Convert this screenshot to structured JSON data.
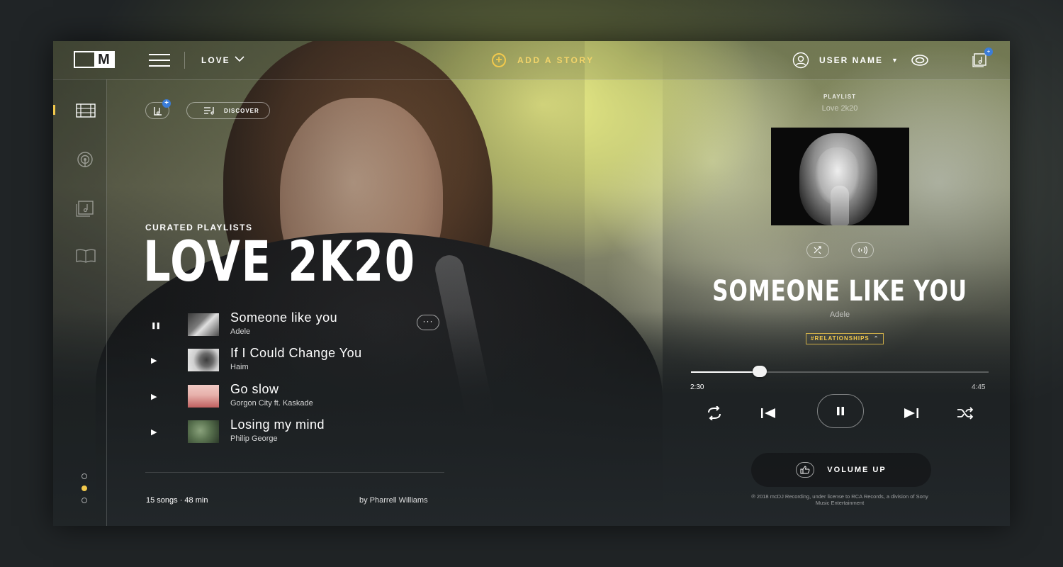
{
  "header": {
    "nav_current": "LOVE",
    "add_story_label": "ADD A STORY",
    "user_name": "USER NAME",
    "library_badge": "+"
  },
  "sidebar": {
    "items": [
      {
        "icon": "film-icon",
        "active": true
      },
      {
        "icon": "podcast-icon",
        "active": false
      },
      {
        "icon": "music-library-icon",
        "active": false
      },
      {
        "icon": "book-icon",
        "active": false
      }
    ],
    "page_indicator": {
      "count": 3,
      "active_index": 1
    }
  },
  "left": {
    "add_badge": "+",
    "discover_label": "DISCOVER",
    "eyebrow": "CURATED PLAYLISTS",
    "title": "LOVE 2K20",
    "more_label": "···",
    "tracks": [
      {
        "state": "pause",
        "state_glyph": "❚❚",
        "title": "Someone like you",
        "artist": "Adele",
        "thumb_colors": [
          "#6b6b6b",
          "#d6d6d6"
        ]
      },
      {
        "state": "play",
        "state_glyph": "▶",
        "title": "If I Could Change You",
        "artist": "Haim",
        "thumb_colors": [
          "#c9c9c9",
          "#5a5a5a"
        ]
      },
      {
        "state": "play",
        "state_glyph": "▶",
        "title": "Go slow",
        "artist": "Gorgon City ft. Kaskade",
        "thumb_colors": [
          "#e6b7b3",
          "#c45a5a"
        ]
      },
      {
        "state": "play",
        "state_glyph": "▶",
        "title": "Losing my mind",
        "artist": "Philip George",
        "thumb_colors": [
          "#5f7a55",
          "#2d3b2a"
        ]
      }
    ],
    "footer_count": "15 songs · 48 min",
    "footer_author": "by Pharrell Williams"
  },
  "player": {
    "playlist_label": "PLAYLIST",
    "playlist_name": "Love 2k20",
    "song_title": "SOMEONE LIKE YOU",
    "artist": "Adele",
    "tag": "#RELATIONSHIPS",
    "tag_caret": "⌃",
    "time_current": "2:30",
    "time_total": "4:45",
    "progress_fraction": 0.23,
    "volume_label": "VOLUME UP",
    "copyright": "℗ 2018 mcDJ Recording, under license to RCA Records, a division of Sony Music Entertainment"
  },
  "colors": {
    "accent": "#f2c94c",
    "badge": "#3b7dd8"
  }
}
